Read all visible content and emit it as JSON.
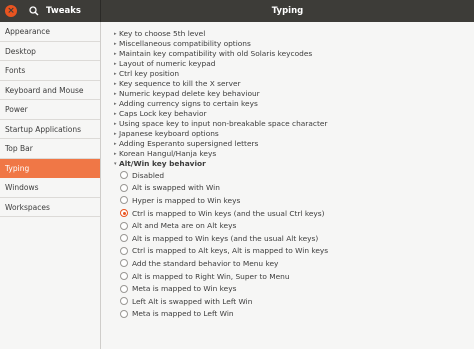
{
  "app": {
    "title": "Tweaks",
    "close_glyph": "×"
  },
  "page": {
    "title": "Typing"
  },
  "sidebar": {
    "items": [
      {
        "label": "Appearance"
      },
      {
        "label": "Desktop"
      },
      {
        "label": "Fonts"
      },
      {
        "label": "Keyboard and Mouse"
      },
      {
        "label": "Power"
      },
      {
        "label": "Startup Applications"
      },
      {
        "label": "Top Bar"
      },
      {
        "label": "Typing",
        "selected": true
      },
      {
        "label": "Windows"
      },
      {
        "label": "Workspaces"
      }
    ]
  },
  "options": {
    "collapsed": [
      "Key to choose 5th level",
      "Miscellaneous compatibility options",
      "Maintain key compatibility with old Solaris keycodes",
      "Layout of numeric keypad",
      "Ctrl key position",
      "Key sequence to kill the X server",
      "Numeric keypad delete key behaviour",
      "Adding currency signs to certain keys",
      "Caps Lock key behavior",
      "Using space key to input non-breakable space character",
      "Japanese keyboard options",
      "Adding Esperanto supersigned letters",
      "Korean Hangul/Hanja keys"
    ],
    "expanded": {
      "label": "Alt/Win key behavior",
      "choices": [
        "Disabled",
        "Alt is swapped with Win",
        "Hyper is mapped to Win keys",
        "Ctrl is mapped to Win keys (and the usual Ctrl keys)",
        "Alt and Meta are on Alt keys",
        "Alt is mapped to Win keys (and the usual Alt keys)",
        "Ctrl is mapped to Alt keys, Alt is mapped to Win keys",
        "Add the standard behavior to Menu key",
        "Alt is mapped to Right Win, Super to Menu",
        "Meta is mapped to Win keys",
        "Left Alt is swapped with Left Win",
        "Meta is mapped to Left Win"
      ],
      "selected_index": 3
    }
  },
  "icons": {
    "search": "search-icon",
    "close": "close-icon",
    "expander_collapsed": "triangle-right-icon",
    "expander_expanded": "triangle-down-icon"
  },
  "colors": {
    "accent": "#e95420",
    "selection": "#f07746",
    "titlebar": "#3d3c38"
  }
}
